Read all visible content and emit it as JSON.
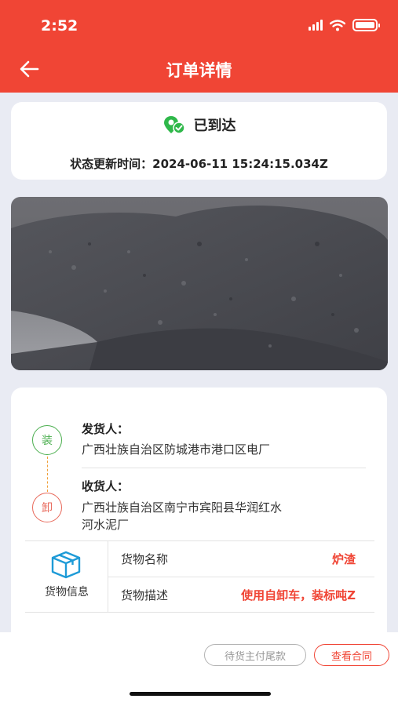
{
  "status_bar": {
    "time": "2:52"
  },
  "header": {
    "title": "订单详情",
    "back_icon": "arrow-left-icon"
  },
  "status": {
    "label": "已到达",
    "icon": "location-check-icon",
    "update_label": "状态更新时间：",
    "update_time": "2024-06-11 15:24:15.034Z"
  },
  "route": {
    "load_badge": "装",
    "unload_badge": "卸",
    "shipper_label": "发货人：",
    "shipper_address": "广西壮族自治区防城港市港口区电厂",
    "receiver_label": "收货人：",
    "receiver_address_line1": "广西壮族自治区南宁市宾阳县华润红水",
    "receiver_address_line2": "河水泥厂"
  },
  "goods": {
    "section_label": "货物信息",
    "icon": "box-icon",
    "rows": [
      {
        "key": "货物名称",
        "value": "炉渣"
      },
      {
        "key": "货物描述",
        "value": "使用自卸车，装标吨Z"
      }
    ]
  },
  "actions": {
    "pending_payment": "待货主付尾款",
    "view_contract": "查看合同"
  },
  "colors": {
    "accent": "#f04535",
    "load": "#4caf50",
    "unload": "#e86a5c",
    "status_icon": "#2fb84a"
  }
}
